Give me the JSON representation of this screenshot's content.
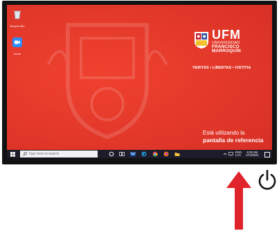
{
  "desktop": {
    "icons": [
      {
        "label": "Recycle Bin",
        "icon": "recycle-bin-icon"
      },
      {
        "label": "Zoom",
        "icon": "zoom-icon"
      }
    ],
    "branding": {
      "acronym": "UFM",
      "line1": "UNIVERSIDAD",
      "line2": "FRANCISCO",
      "line3": "MARROQUÍN",
      "motto": "VERITAS • LIBERTAS • IVSTITIA"
    },
    "reference_message": {
      "line1": "Está utilizando la",
      "line2": "pantalla de referencia"
    }
  },
  "taskbar": {
    "search_placeholder": "Type here to search",
    "apps": [
      "cortana-icon",
      "task-view-icon",
      "mail-icon",
      "edge-icon",
      "chrome-icon",
      "firefox-icon",
      "file-explorer-icon"
    ],
    "tray": {
      "language": "ENG",
      "region": "LAA",
      "time": "8:30 AM",
      "date": "1/14/2021"
    }
  },
  "colors": {
    "wallpaper": "#e2382a",
    "taskbar": "#1e1c2a",
    "arrow": "#e0242b"
  }
}
